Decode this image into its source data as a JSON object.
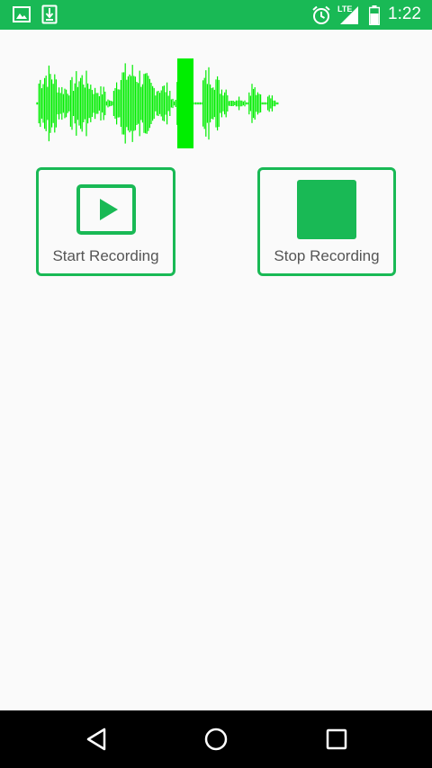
{
  "status_bar": {
    "time": "1:22",
    "network_label": "LTE",
    "icons": [
      "image-icon",
      "download-icon",
      "alarm-icon",
      "signal-icon",
      "battery-icon"
    ]
  },
  "waveform": {
    "color": "#00ee00"
  },
  "buttons": {
    "start_label": "Start Recording",
    "stop_label": "Stop Recording"
  },
  "nav_bar": {
    "icons": [
      "back-icon",
      "home-icon",
      "recents-icon"
    ]
  },
  "colors": {
    "accent": "#19b955",
    "background": "#fafafa",
    "label_text": "#555555",
    "nav_background": "#000000"
  }
}
